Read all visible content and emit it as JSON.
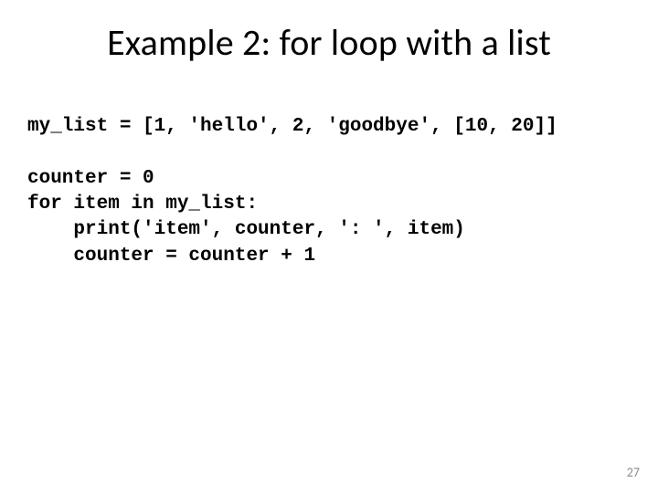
{
  "title": "Example 2: for loop with a list",
  "code": "my_list = [1, 'hello', 2, 'goodbye', [10, 20]]\n\ncounter = 0\nfor item in my_list:\n    print('item', counter, ': ', item)\n    counter = counter + 1",
  "page_number": "27"
}
